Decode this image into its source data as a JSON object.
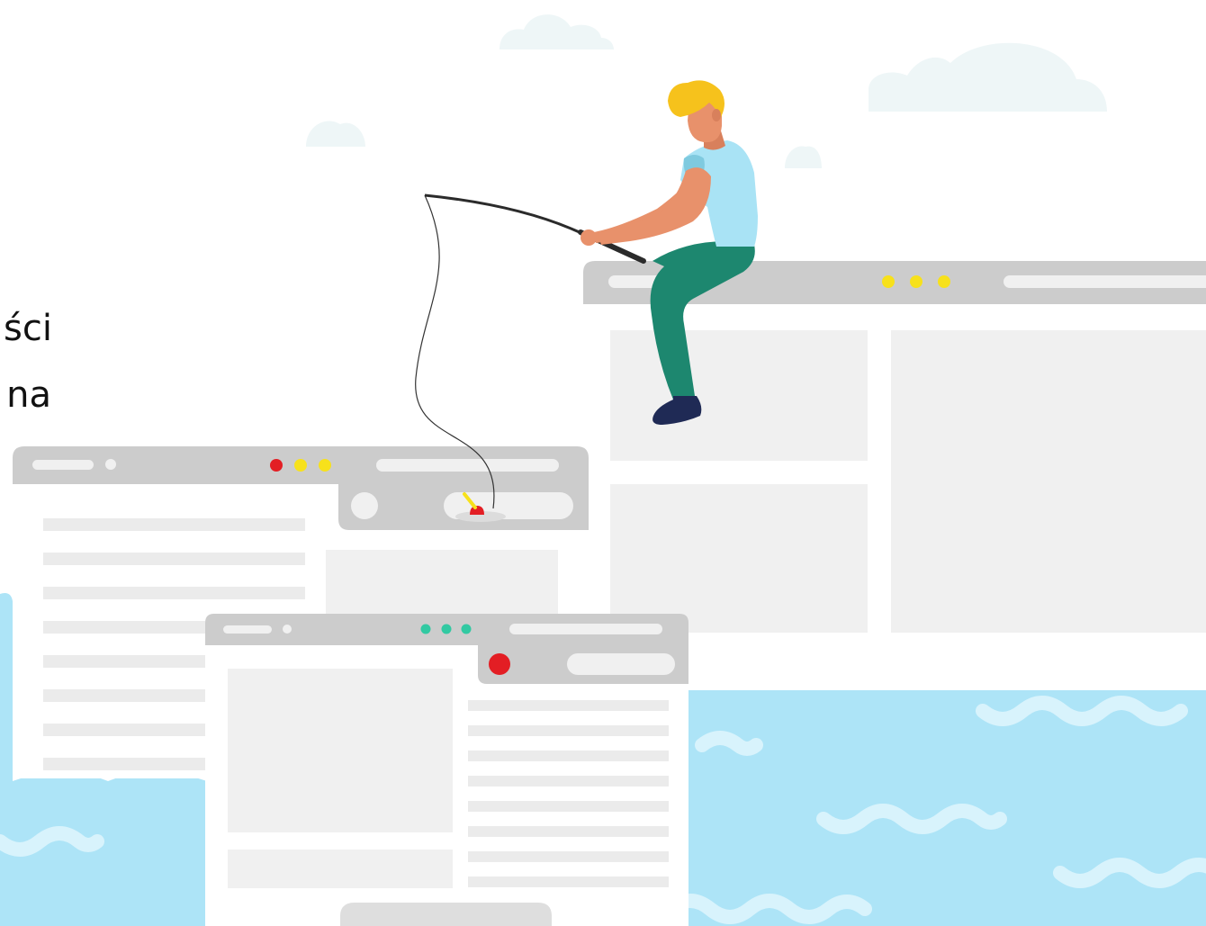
{
  "text": {
    "fragment_1": "ści",
    "fragment_2": "na"
  },
  "colors": {
    "background": "#ffffff",
    "cloud": "#eef6f7",
    "window_bar": "#cccccc",
    "window_body": "#ffffff",
    "placeholder_block": "#f0f0f0",
    "placeholder_line": "#ebebeb",
    "water": "#ade4f7",
    "water_wave": "#d8f3fc",
    "dot_red": "#e31e24",
    "dot_yellow": "#f7e11b",
    "dot_teal": "#32c9a2",
    "hair": "#f6c21c",
    "skin": "#e8916b",
    "shirt": "#a9e3f5",
    "pants": "#1d876f",
    "shoe": "#1f2a55",
    "rod": "#2b2b2b"
  },
  "icons": {
    "browser_window": "browser-window-icon",
    "fisherman": "fisherman-illustration",
    "fishing_float": "fishing-float-icon",
    "cloud": "cloud-icon",
    "wave": "wave-icon"
  }
}
